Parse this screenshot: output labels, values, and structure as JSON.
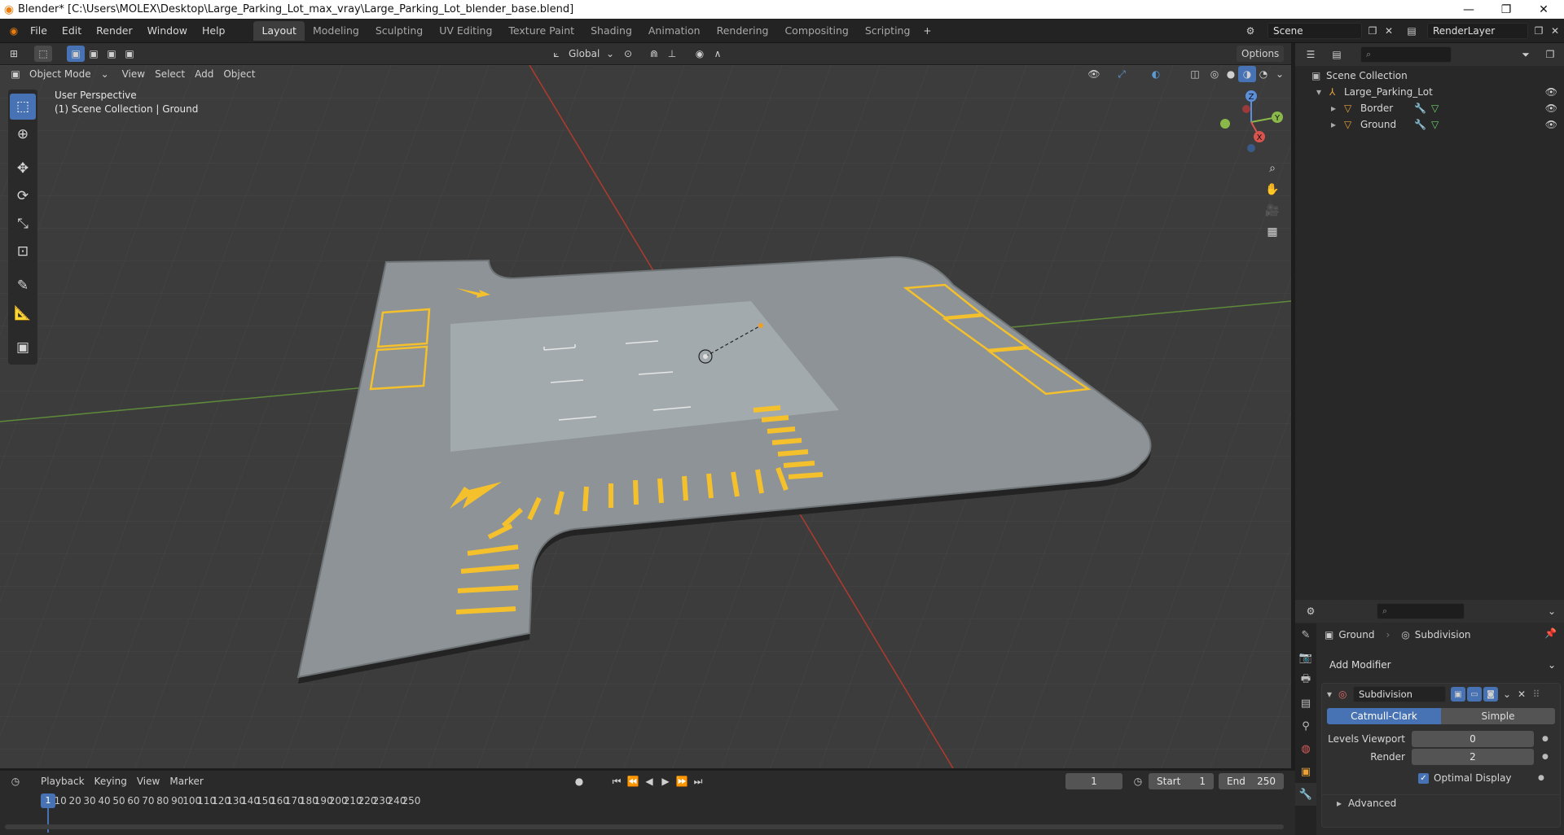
{
  "window": {
    "title": "Blender* [C:\\Users\\MOLEX\\Desktop\\Large_Parking_Lot_max_vray\\Large_Parking_Lot_blender_base.blend]"
  },
  "menus": [
    "File",
    "Edit",
    "Render",
    "Window",
    "Help"
  ],
  "workspaces": [
    "Layout",
    "Modeling",
    "Sculpting",
    "UV Editing",
    "Texture Paint",
    "Shading",
    "Animation",
    "Rendering",
    "Compositing",
    "Scripting"
  ],
  "active_workspace": "Layout",
  "scene": {
    "name": "Scene",
    "view_layer": "RenderLayer"
  },
  "viewport": {
    "mode": "Object Mode",
    "header_menus": [
      "View",
      "Select",
      "Add",
      "Object"
    ],
    "transform_orientation": "Global",
    "options_label": "Options",
    "perspective_label": "User Perspective",
    "collection_label": "(1) Scene Collection | Ground",
    "gizmo_axes": {
      "x": "X",
      "y": "Y",
      "z": "Z"
    }
  },
  "outliner": {
    "root": "Scene Collection",
    "collection": "Large_Parking_Lot",
    "objects": [
      "Border",
      "Ground"
    ]
  },
  "properties": {
    "object_name": "Ground",
    "modifier_breadcrumb": "Subdivision",
    "add_modifier_label": "Add Modifier",
    "modifier_name": "Subdivision",
    "methods": [
      "Catmull-Clark",
      "Simple"
    ],
    "active_method": "Catmull-Clark",
    "levels_viewport_label": "Levels Viewport",
    "levels_viewport": "0",
    "render_label": "Render",
    "render_levels": "2",
    "optimal_display_label": "Optimal Display",
    "optimal_display": true,
    "advanced_label": "Advanced"
  },
  "timeline": {
    "menus": [
      "Playback",
      "Keying",
      "View",
      "Marker"
    ],
    "current_frame": "1",
    "start_label": "Start",
    "start": "1",
    "end_label": "End",
    "end": "250",
    "ticks": [
      "1",
      "10",
      "20",
      "30",
      "40",
      "50",
      "60",
      "70",
      "80",
      "90",
      "100",
      "110",
      "120",
      "130",
      "140",
      "150",
      "160",
      "170",
      "180",
      "190",
      "200",
      "210",
      "220",
      "230",
      "240",
      "250"
    ]
  },
  "colors": {
    "accent": "#4772b3",
    "header": "#303030",
    "viewport_bg": "#3c3c3c",
    "x_axis": "#c0392b",
    "y_axis": "#6aa84f",
    "parking_lines": "#f4c02b"
  }
}
